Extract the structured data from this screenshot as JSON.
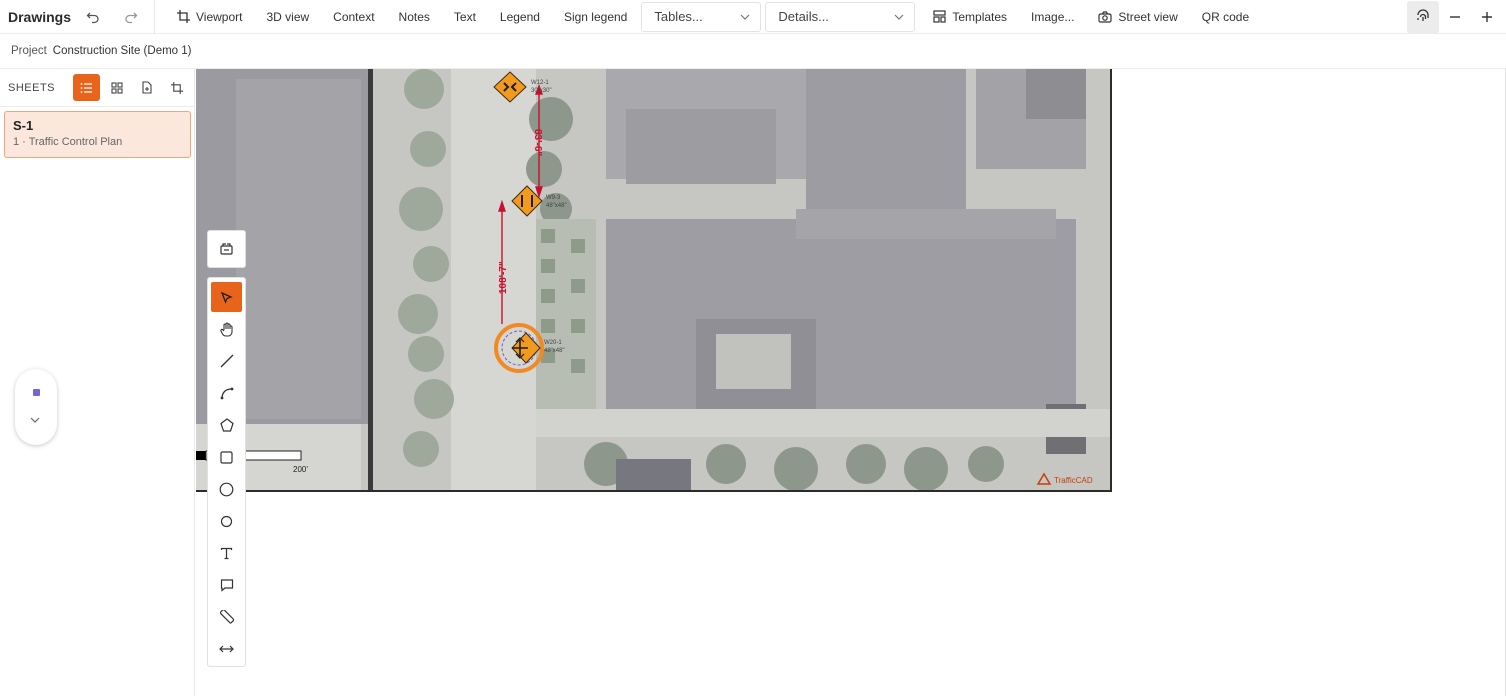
{
  "toolbar": {
    "app_title": "Drawings",
    "items": [
      {
        "label": "Viewport",
        "icon": "crop-icon"
      },
      {
        "label": "3D view"
      },
      {
        "label": "Context"
      },
      {
        "label": "Notes"
      },
      {
        "label": "Text"
      },
      {
        "label": "Legend"
      },
      {
        "label": "Sign legend"
      }
    ],
    "tables_dropdown": "Tables...",
    "details_dropdown": "Details...",
    "templates": "Templates",
    "image": "Image...",
    "street_view": "Street view",
    "qr_code": "QR code"
  },
  "project": {
    "label": "Project",
    "name": "Construction Site (Demo 1)"
  },
  "sidebar": {
    "heading": "SHEETS",
    "sheets": [
      {
        "code": "S-1",
        "subtitle": "1 · Traffic Control Plan"
      }
    ]
  },
  "map": {
    "dim_top": "83'-6\"",
    "dim_mid": "108'-7\"",
    "signs": [
      {
        "code": "W12-1",
        "size": "30\"x30\""
      },
      {
        "code": "W9-3",
        "size": "48\"x48\""
      },
      {
        "code": "W20-1",
        "size": "48\"x48\""
      }
    ],
    "scale_label": "200'",
    "attribution": "TrafficCAD"
  },
  "colors": {
    "accent": "#e8641b",
    "sheet_bg": "#fbe7dc",
    "dimension": "#c8102e",
    "sign": "#f29a1d",
    "zoom_dot": "#7565d8"
  }
}
